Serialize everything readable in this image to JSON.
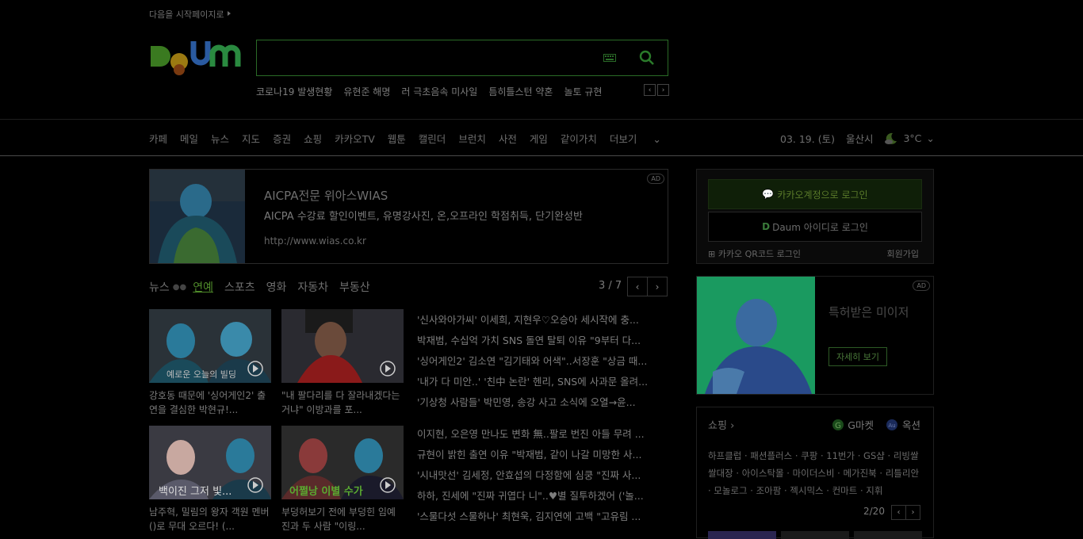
{
  "top": {
    "start_page": "다음을 시작페이지로"
  },
  "search": {
    "placeholder": ""
  },
  "issues": [
    "코로나19 발생현황",
    "유현준 해명",
    "러 극초음속 미사일",
    "틈히틀스턴 약혼",
    "놀토 규현"
  ],
  "gnb": {
    "items": [
      "카페",
      "메일",
      "뉴스",
      "지도",
      "증권",
      "쇼핑",
      "카카오TV",
      "웹툰",
      "캘린더",
      "브런치",
      "사전",
      "게임",
      "같이가치",
      "더보기"
    ],
    "date": "03. 19. (토)",
    "location": "울산시",
    "temp": "3°C"
  },
  "ad1": {
    "badge": "AD",
    "title": "AICPA전문 위아스WIAS",
    "desc": "AICPA 수강료 할인이벤트, 유명강사진, 온,오프라인 학점취득, 단기완성반",
    "url": "http://www.wias.co.kr"
  },
  "news": {
    "tabs": [
      "뉴스",
      "연예",
      "스포츠",
      "영화",
      "자동차",
      "부동산"
    ],
    "pager": "3 / 7",
    "thumbs": [
      {
        "overlay": "예로운 오늘의 빌딩",
        "caption": "강호동 때문에 '싱어게인2' 출연을 결심한 박현규!..."
      },
      {
        "overlay": "",
        "caption": "\"내 팔다리를 다 잘라내겠다는 거냐\" 이방과를 포..."
      },
      {
        "overlay": "백이진 그저 빛...",
        "caption": "남주혁, 밀림의 왕자 객원 멘버()로 무대 오르다! (..."
      },
      {
        "overlay": "어쩔낭 이별 수가",
        "caption": "부덩허보기 전에 부덩힌 임예진과 두 사람 \"이링..."
      }
    ],
    "list1": [
      "'신사와아가씨' 이세희, 지현우♡오승아 세시작에 충...",
      "박재범, 수십억 가치 SNS 돌연 탈퇴 이유 \"9부터 다...",
      "'싱어게인2' 김소연 \"김기태와 어색\"..서장훈 \"상금 때...",
      "'내가 다 미안..' '친中 논란' 헨리, SNS에 사과문 올려...",
      "'기상청 사람들' 박민영, 송강 사고 소식에 오열→윤..."
    ],
    "list2": [
      "이지현, 오은영 만나도 변화 無..팔로 번진 아들 무려 ...",
      "규현이 밝힌 출연 이유 \"박재범, 같이 나갈 미망한 사...",
      "'시내맛선' 김세정, 안효섭의 다정함에 심쿵 \"진짜 사...",
      "하하, 진세에 \"진짜 귀엽다 니\"..♥별 질투하겠어 ('놀...",
      "'스물다섯 스물하나' 최현욱, 김지연에 고백 \"고유림 ..."
    ]
  },
  "login": {
    "kakao": "카카오계정으로 로그인",
    "daum": "Daum 아이디로 로그인",
    "qr": "카카오 QR코드 로그인",
    "signup": "회원가입"
  },
  "ad2": {
    "badge": "AD",
    "title": "특허받은 미이저",
    "button": "자세히 보기"
  },
  "shopping": {
    "title": "쇼핑",
    "partner1": "G마켓",
    "partner2": "옥션",
    "links": "하프클럽 · 패션플러스 · 쿠팡 · 11번가 · GS샵 · 리빙쌀쌀대장 · 아이스탁몰 · 마이더스비 · 메가진북 · 리틀리안 · 모놀로그 · 조아팜 · 젝시믹스 · 컨마트 · 지휘",
    "pager": "2/20"
  },
  "colors": {
    "brand_green": "#2a6b27",
    "active_tab": "#4f8a2a"
  }
}
